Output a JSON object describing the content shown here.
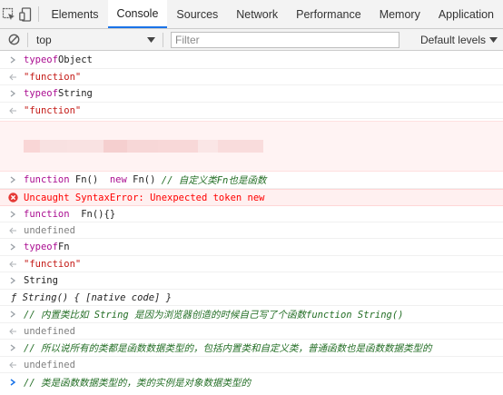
{
  "tabs": {
    "elements": "Elements",
    "console": "Console",
    "sources": "Sources",
    "network": "Network",
    "performance": "Performance",
    "memory": "Memory",
    "application": "Application"
  },
  "toolbar": {
    "context": "top",
    "filter_placeholder": "Filter",
    "levels": "Default levels"
  },
  "console": {
    "r1_kw": "typeof",
    "r1_txt": " Object",
    "r2": "\"function\"",
    "r3_kw": "typeof",
    "r3_txt": " String",
    "r4": "\"function\"",
    "r6_kw1": "function",
    "r6_txt1": " Fn()  ",
    "r6_kw2": "new",
    "r6_txt2": " Fn() ",
    "r6_cm": "// 自定义类Fn也是函数",
    "r7": "Uncaught SyntaxError: Unexpected token new",
    "r8_kw": "function",
    "r8_txt": "  Fn(){}",
    "r9": "undefined",
    "r10_kw": "typeof",
    "r10_txt": " Fn",
    "r11": "\"function\"",
    "r12": "String",
    "r13_f": "ƒ",
    "r13_txt": " String() { [native code] }",
    "r14": "// 内置类比如 String 是因为浏览器创造的时候自己写了个函数function String()",
    "r15": "undefined",
    "r16": "// 所以说所有的类都是函数数据类型的，包括内置类和自定义类，普通函数也是函数数据类型的",
    "r17": "undefined",
    "r18": "// 类是函数数据类型的，类的实例是对象数据类型的"
  },
  "colors": {
    "keyword": "#aa0d91",
    "comment": "#236e25",
    "string": "#c41a16",
    "error": "#ff0000",
    "active_tab": "#1a73e8"
  },
  "icons": [
    "inspect-element-icon",
    "device-toolbar-icon",
    "clear-console-icon",
    "dropdown-arrow-icon",
    "input-chevron-icon",
    "result-arrow-icon",
    "error-icon",
    "prompt-icon"
  ]
}
